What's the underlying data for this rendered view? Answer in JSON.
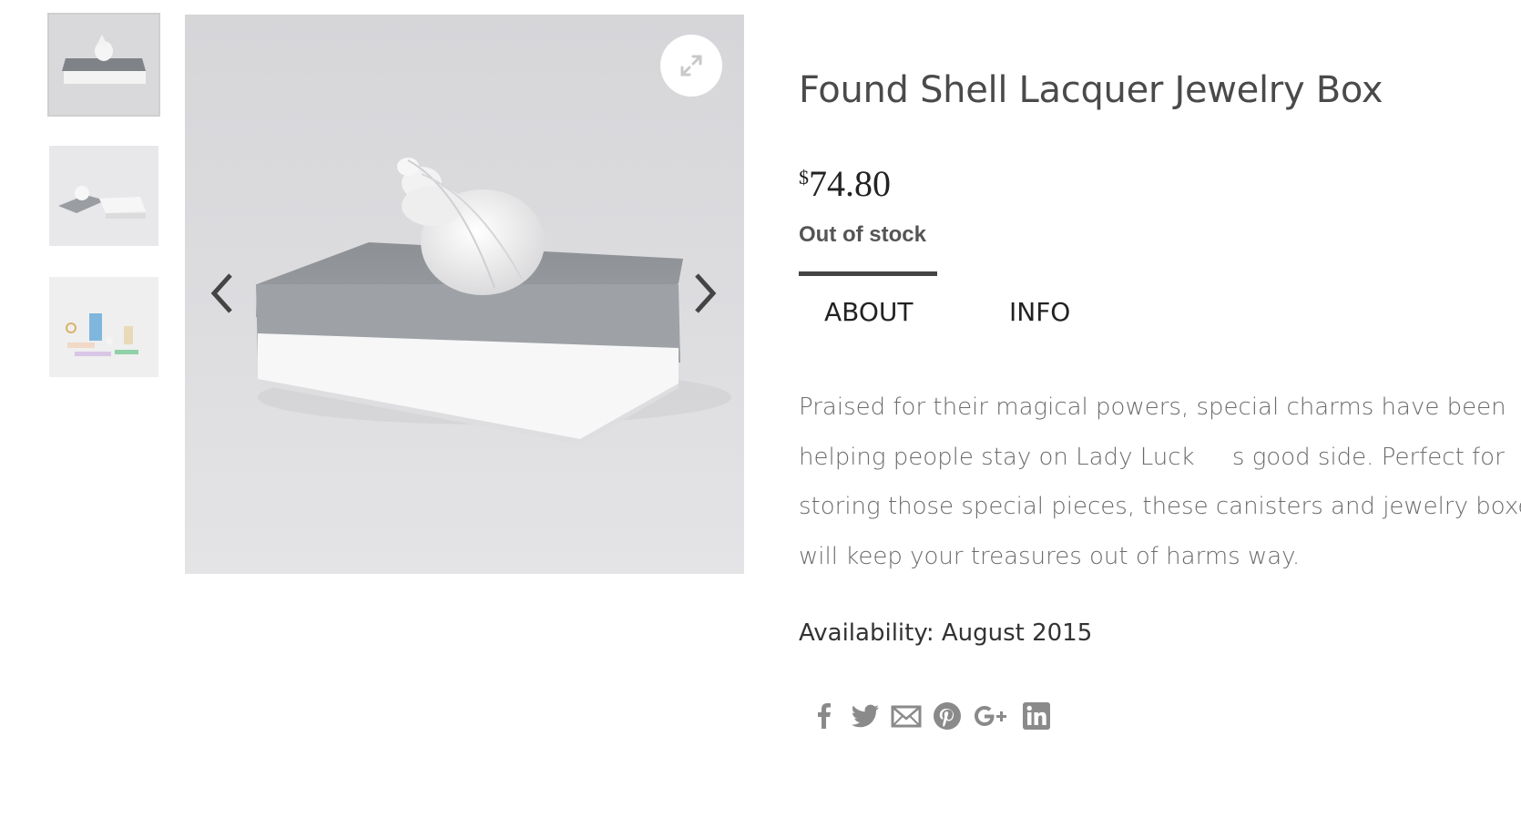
{
  "product": {
    "title": "Found Shell Lacquer Jewelry Box",
    "price_currency": "$",
    "price_amount": "74.80",
    "stock_status": "Out of stock"
  },
  "tabs": [
    {
      "label": "ABOUT",
      "active": true
    },
    {
      "label": "INFO",
      "active": false
    }
  ],
  "description": [
    "Praised for their magical powers, special charms have been",
    "helping people stay on Lady Luck     s good side. Perfect for",
    "storing those special pieces, these canisters and jewelry boxes",
    "will keep your treasures out of harms way."
  ],
  "availability": "Availability: August 2015",
  "share_icons": [
    "facebook-icon",
    "twitter-icon",
    "email-icon",
    "pinterest-icon",
    "google-plus-icon",
    "linkedin-icon"
  ],
  "colors": {
    "icon_gray": "#8a8a8a",
    "title": "#4a4a4a",
    "tab_underline": "#444444"
  }
}
